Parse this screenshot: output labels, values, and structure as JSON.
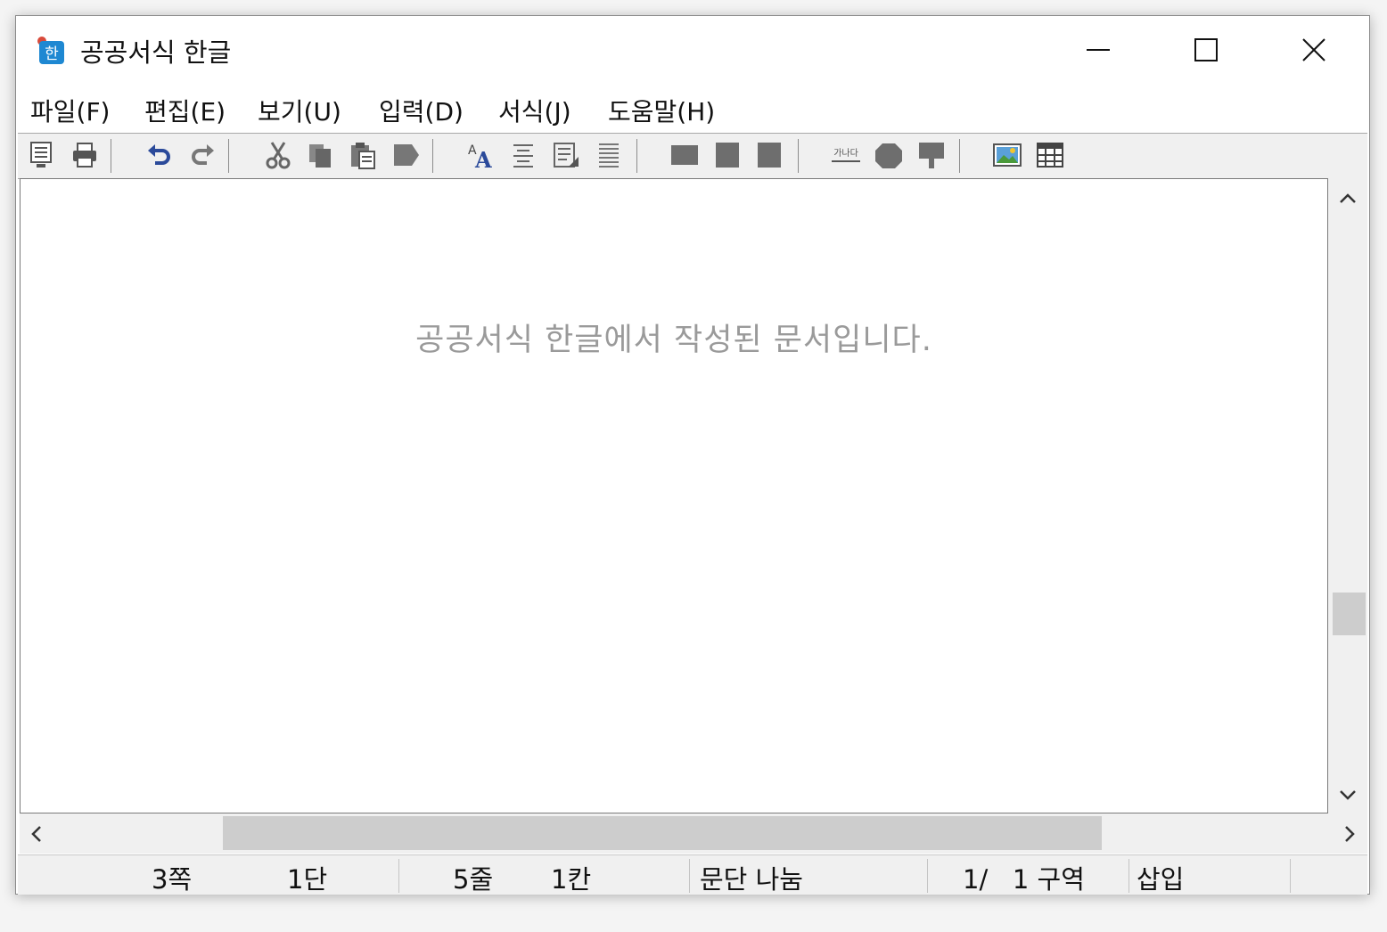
{
  "window": {
    "title": "공공서식 한글"
  },
  "menu": [
    "파일(F)",
    "편집(E)",
    "보기(U)",
    "입력(D)",
    "서식(J)",
    "도움말(H)"
  ],
  "toolbar": {
    "icons": [
      "preview-icon",
      "print-icon",
      "undo-icon",
      "redo-icon",
      "cut-icon",
      "copy-icon",
      "paste-icon",
      "format-paste-icon",
      "char-shape-icon",
      "para-shape-icon",
      "style-icon",
      "line-spacing-icon",
      "align-left-icon",
      "align-center-icon",
      "align-right-icon",
      "text-caption-icon",
      "shape-icon",
      "flag-icon",
      "picture-icon",
      "table-icon"
    ]
  },
  "document": {
    "text": "공공서식 한글에서 작성된 문서입니다."
  },
  "status": {
    "page": "3쪽",
    "column": "1단",
    "line": "5줄",
    "col": "1칸",
    "break": "문단 나눔",
    "section": "1/   1 구역",
    "mode": "삽입"
  }
}
